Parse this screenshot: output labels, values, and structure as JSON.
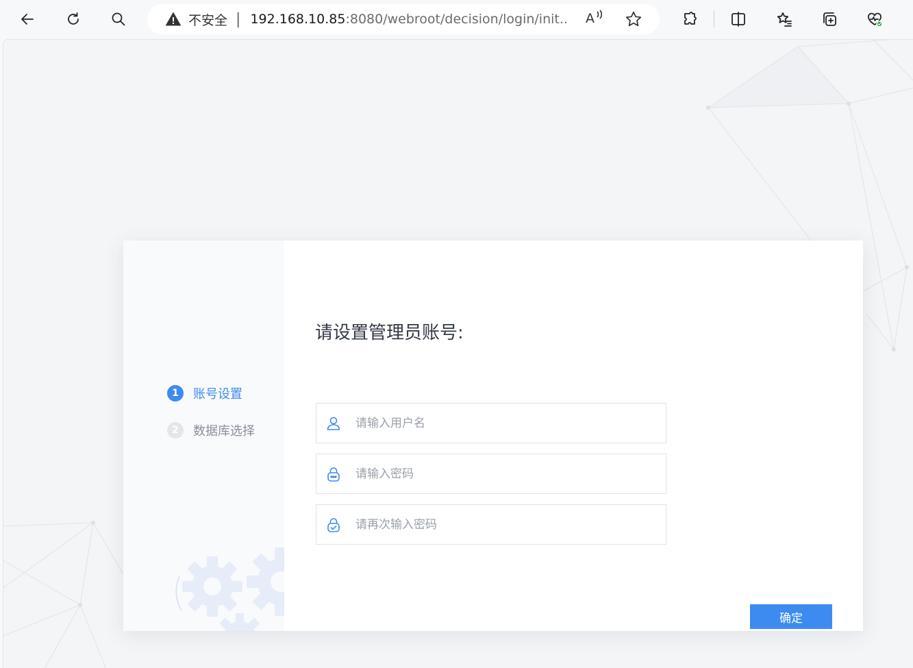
{
  "browser": {
    "security_label": "不安全",
    "separator": "|",
    "url_host": "192.168.10.85",
    "url_rest": ":8080/webroot/decision/login/init...",
    "read_aloud_label": "A",
    "icons": [
      "back-icon",
      "refresh-icon",
      "search-icon",
      "warning-icon",
      "read-aloud-icon",
      "favorite-star-icon",
      "extensions-icon",
      "split-screen-icon",
      "favorites-icon",
      "collections-icon",
      "browser-essentials-icon"
    ]
  },
  "sidebar": {
    "steps": [
      {
        "number": "1",
        "label": "账号设置",
        "active": true
      },
      {
        "number": "2",
        "label": "数据库选择",
        "active": false
      }
    ]
  },
  "form": {
    "title": "请设置管理员账号:",
    "username": {
      "value": "",
      "placeholder": "请输入用户名",
      "icon": "user-icon"
    },
    "password": {
      "value": "",
      "placeholder": "请输入密码",
      "icon": "lock-icon"
    },
    "password_confirm": {
      "value": "",
      "placeholder": "请再次输入密码",
      "icon": "lock-check-icon"
    },
    "confirm_label": "确定"
  },
  "colors": {
    "accent": "#3d8bf0",
    "inactive_step": "#e4e6ea"
  }
}
